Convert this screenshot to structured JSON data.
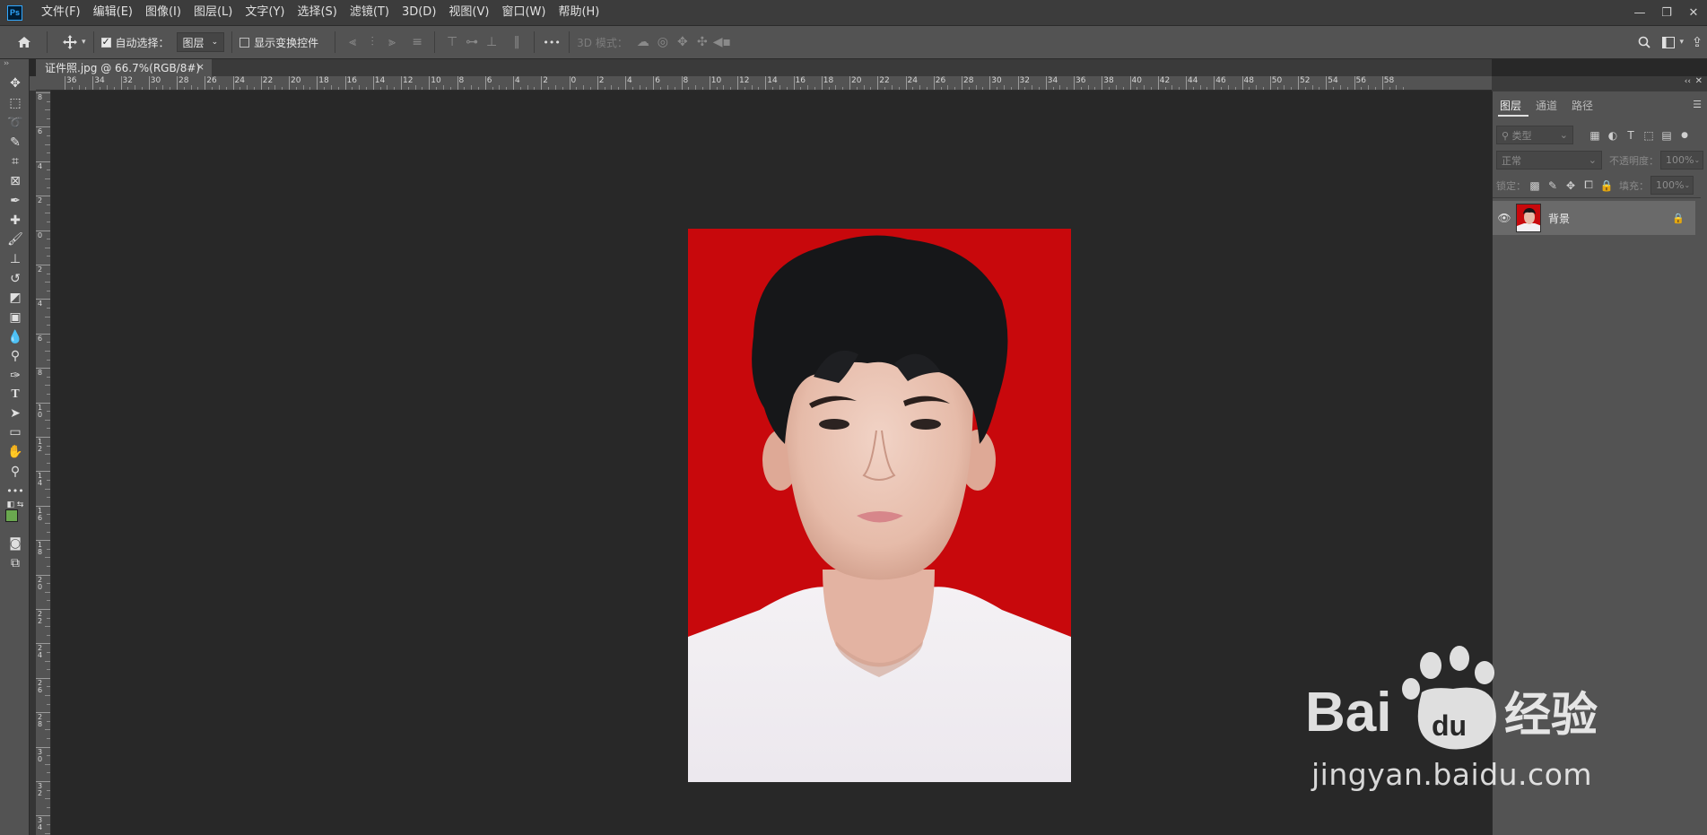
{
  "app": {
    "logo": "Ps"
  },
  "menu": [
    "文件(F)",
    "编辑(E)",
    "图像(I)",
    "图层(L)",
    "文字(Y)",
    "选择(S)",
    "滤镜(T)",
    "3D(D)",
    "视图(V)",
    "窗口(W)",
    "帮助(H)"
  ],
  "window_controls": {
    "minimize": "—",
    "restore": "❐",
    "close": "✕"
  },
  "options": {
    "auto_select_label": "自动选择：",
    "auto_select_target": "图层",
    "show_transform_label": "显示变换控件",
    "more": "•••",
    "mode_3d_label": "3D 模式："
  },
  "document": {
    "tab_title": "证件照.jpg @ 66.7%(RGB/8#)",
    "close": "×"
  },
  "rulers": {
    "top_labels": [
      "36",
      "34",
      "32",
      "30",
      "28",
      "26",
      "24",
      "22",
      "20",
      "18",
      "16",
      "14",
      "12",
      "10",
      "8",
      "6",
      "4",
      "2",
      "0",
      "2",
      "4",
      "6",
      "8",
      "10",
      "12",
      "14",
      "16",
      "18",
      "20",
      "22",
      "24",
      "26",
      "28",
      "30",
      "32",
      "34",
      "36",
      "38",
      "40",
      "42",
      "44",
      "46",
      "48",
      "50",
      "52",
      "54",
      "56",
      "58"
    ],
    "left_labels": [
      "8",
      "6",
      "4",
      "2",
      "0",
      "2",
      "4",
      "6",
      "8",
      "1 0",
      "1 2",
      "1 4",
      "1 6",
      "1 8",
      "2 0",
      "2 2",
      "2 4",
      "2 6",
      "2 8",
      "3 0",
      "3 2",
      "3 4"
    ]
  },
  "panel": {
    "tabs": [
      "图层",
      "通道",
      "路径"
    ],
    "active_tab": "图层",
    "filter_label": "类型",
    "blend_mode": "正常",
    "opacity_label": "不透明度：",
    "opacity_value": "100%",
    "lock_label": "锁定：",
    "fill_label": "填充：",
    "fill_value": "100%",
    "layers": [
      {
        "name": "背景",
        "visible": true,
        "locked": true
      }
    ]
  },
  "colors": {
    "foreground": "#6aa84f",
    "background": "#ffffff",
    "photo_background": "#c8080c",
    "accent": "#31a8ff"
  },
  "watermark": {
    "brand": "Bai",
    "brand_cn": "经验",
    "du": "du",
    "url": "jingyan.baidu.com"
  }
}
